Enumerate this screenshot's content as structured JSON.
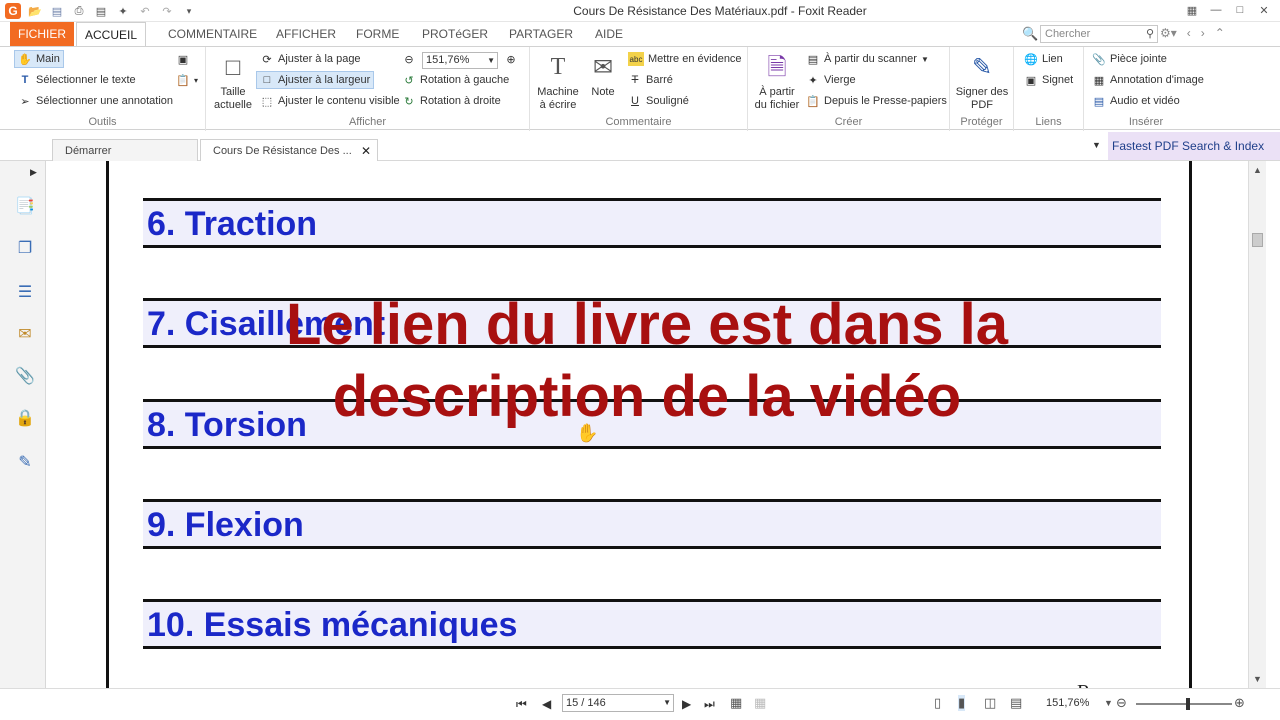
{
  "window": {
    "title": "Cours De Résistance Des Matériaux.pdf - Foxit Reader"
  },
  "ribbon_tabs": [
    "FICHIER",
    "ACCUEIL",
    "COMMENTAIRE",
    "AFFICHER",
    "FORME",
    "PROTéGER",
    "PARTAGER",
    "AIDE"
  ],
  "search": {
    "placeholder": "Chercher"
  },
  "groups": {
    "outils": {
      "label": "Outils",
      "items": [
        "Main",
        "Sélectionner le texte",
        "Sélectionner une annotation"
      ]
    },
    "afficher": {
      "label": "Afficher",
      "taille_actuelle": "Taille actuelle",
      "items": [
        "Ajuster à la page",
        "Ajuster à la largeur",
        "Ajuster le contenu visible"
      ],
      "zoom_value": "151,76%",
      "rotations": [
        "Rotation à gauche",
        "Rotation à droite"
      ]
    },
    "commentaire": {
      "label": "Commentaire",
      "machine": "Machine à écrire",
      "note": "Note",
      "items": [
        "Mettre en évidence",
        "Barré",
        "Souligné"
      ]
    },
    "creer": {
      "label": "Créer",
      "from_file": "À partir du fichier",
      "items": [
        "À partir du scanner",
        "Vierge",
        "Depuis le Presse-papiers"
      ]
    },
    "proteger": {
      "label": "Protéger",
      "sign": "Signer des PDF"
    },
    "liens": {
      "label": "Liens",
      "items": [
        "Lien",
        "Signet"
      ]
    },
    "inserer": {
      "label": "Insérer",
      "items": [
        "Pièce jointe",
        "Annotation d'image",
        "Audio et vidéo"
      ]
    }
  },
  "doc_tabs": [
    "Démarrer",
    "Cours De Résistance Des ..."
  ],
  "plugin_panel": "Fastest PDF Search & Index",
  "document": {
    "chapters": [
      "6.  Traction",
      "7.  Cisaillement",
      "8.  Torsion",
      "9.  Flexion",
      "10.  Essais mécaniques"
    ],
    "overlay_lines": [
      "Le lien du livre est dans la",
      "description de la vidéo"
    ],
    "page_letter": "R"
  },
  "statusbar": {
    "page": "15 / 146",
    "zoom": "151,76%"
  },
  "colors": {
    "accent": "#f26b22",
    "chapter_text": "#1b28c8",
    "chapter_bg": "#efeffb",
    "overlay_text": "#a81010",
    "plugin_bg": "#ebe1f6"
  },
  "icons": [
    "hand-icon",
    "text-select-icon",
    "annotation-select-icon",
    "fit-page-icon",
    "fit-width-icon",
    "fit-visible-icon",
    "zoom-out-icon",
    "zoom-in-icon",
    "rotate-left-icon",
    "rotate-right-icon",
    "typewriter-icon",
    "note-icon",
    "highlight-icon",
    "strikeout-icon",
    "underline-icon",
    "from-file-icon",
    "scanner-icon",
    "blank-icon",
    "clipboard-icon",
    "sign-icon",
    "link-icon",
    "bookmark-icon",
    "attachment-icon",
    "image-annotation-icon",
    "audio-video-icon"
  ]
}
